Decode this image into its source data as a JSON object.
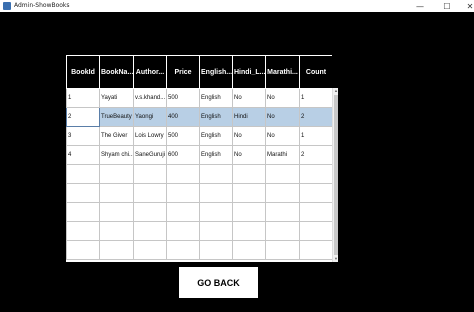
{
  "window": {
    "title": "Admin-ShowBooks",
    "minimize": "—",
    "maximize": "☐",
    "close": "✕"
  },
  "table": {
    "headers": [
      "BookId",
      "BookNa...",
      "Author...",
      "Price",
      "English...",
      "Hindi_L...",
      "Marathi...",
      "Count"
    ],
    "rows": [
      [
        "1",
        "Yayati",
        "v.s.khand...",
        "500",
        "English",
        "No",
        "No",
        "1"
      ],
      [
        "2",
        "TrueBeauty",
        "Yaongi",
        "400",
        "English",
        "Hindi",
        "No",
        "2"
      ],
      [
        "3",
        "The Giver",
        "Lois Lowry",
        "500",
        "English",
        "No",
        "No",
        "1"
      ],
      [
        "4",
        "Shyam chi...",
        "SaneGuruji",
        "600",
        "English",
        "No",
        "Marathi",
        "2"
      ],
      [
        "",
        "",
        "",
        "",
        "",
        "",
        "",
        ""
      ],
      [
        "",
        "",
        "",
        "",
        "",
        "",
        "",
        ""
      ],
      [
        "",
        "",
        "",
        "",
        "",
        "",
        "",
        ""
      ],
      [
        "",
        "",
        "",
        "",
        "",
        "",
        "",
        ""
      ],
      [
        "",
        "",
        "",
        "",
        "",
        "",
        "",
        ""
      ]
    ],
    "selected_row": 1
  },
  "actions": {
    "go_back": "GO BACK"
  },
  "colors": {
    "background": "#000000",
    "selection": "#b8cfe5",
    "header_bg": "#000000",
    "header_text": "#ffffff"
  }
}
